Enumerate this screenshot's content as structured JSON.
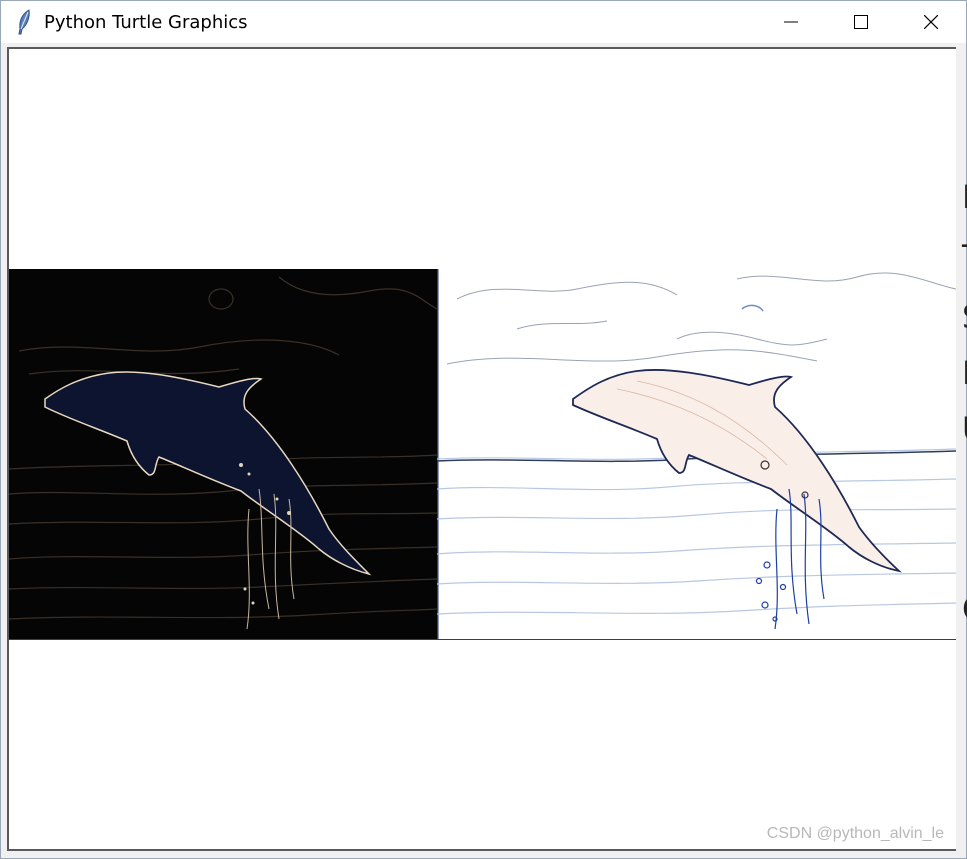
{
  "window": {
    "title": "Python Turtle Graphics",
    "controls": {
      "minimize": "minimize-icon",
      "maximize": "maximize-icon",
      "close": "close-icon"
    }
  },
  "side_text_fragments": [
    "I",
    "T",
    "S",
    "I",
    "U",
    "C"
  ],
  "images": {
    "left": {
      "name": "dolphin-edge-dark",
      "background": "#000000",
      "outline": "#e8d8c0"
    },
    "right": {
      "name": "dolphin-edge-light",
      "background": "#ffffff",
      "outline": "#2a3c7a"
    }
  },
  "watermark": "CSDN @python_alvin_le"
}
